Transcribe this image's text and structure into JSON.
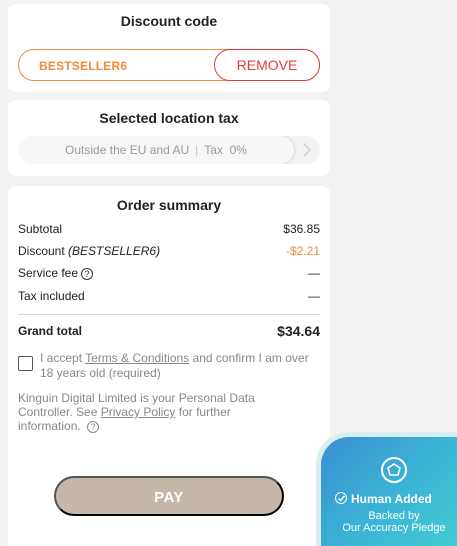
{
  "discount": {
    "title": "Discount code",
    "code": "BESTSELLER6",
    "remove_label": "REMOVE"
  },
  "location_tax": {
    "title": "Selected location tax",
    "region": "Outside the EU and AU",
    "tax": "Tax  0%"
  },
  "summary": {
    "title": "Order summary",
    "subtotal_label": "Subtotal",
    "subtotal_value": "$36.85",
    "discount_label": "Discount",
    "discount_code": "(BESTSELLER6)",
    "discount_value": "-$2.21",
    "service_fee_label": "Service fee",
    "service_fee_value": "—",
    "tax_included_label": "Tax included",
    "tax_included_value": "—",
    "grand_total_label": "Grand total",
    "grand_total_value": "$34.64"
  },
  "terms": {
    "text_before": "I accept ",
    "link": "Terms & Conditions",
    "text_after": " and confirm I am over 18 years old (required)"
  },
  "legal": {
    "text_before": "Kinguin Digital Limited is your Personal Data Controller. See ",
    "link": "Privacy Policy",
    "text_after": " for further information."
  },
  "pay_label": "PAY",
  "badge": {
    "title": "Human Added",
    "line1": "Backed by",
    "line2": "Our Accuracy Pledge"
  },
  "colors": {
    "accent_orange": "#f08a3c",
    "remove_red": "#e83a3a",
    "pay_button": "#c4b6a8"
  }
}
